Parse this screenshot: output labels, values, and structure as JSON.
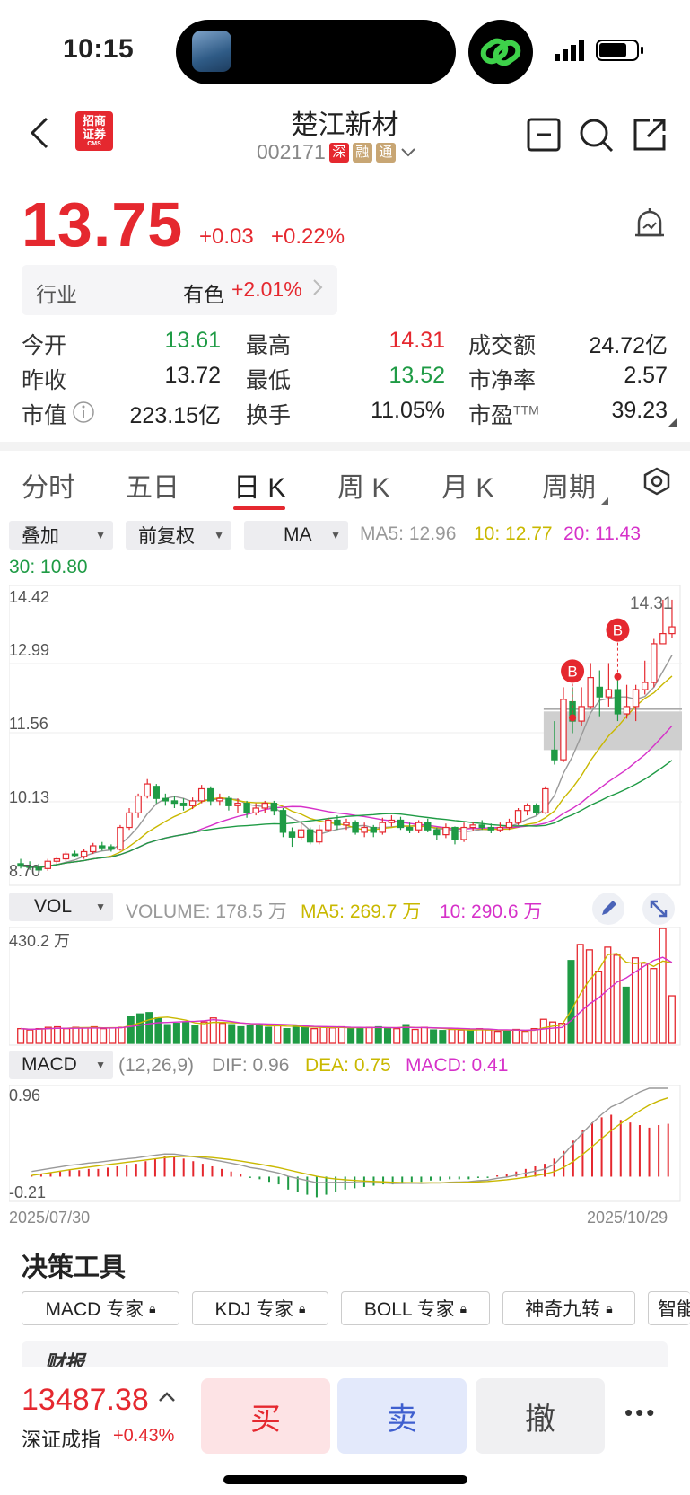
{
  "status_bar": {
    "time": "10:15"
  },
  "header": {
    "back_icon": "chevron-left-icon",
    "broker_logo_text": "招商证券",
    "broker_logo_sub": "CMS",
    "stock_name": "楚江新材",
    "stock_code": "002171",
    "tags": [
      "深",
      "融",
      "通"
    ],
    "actions": [
      "minus-box-icon",
      "search-icon",
      "share-icon"
    ]
  },
  "quote": {
    "price": "13.75",
    "change": "+0.03",
    "change_pct": "+0.22%",
    "industry_label": "行业",
    "industry_name": "有色",
    "industry_change": "+2.01%",
    "stats": [
      [
        {
          "label": "今开",
          "value": "13.61",
          "color": "#1f9b45"
        },
        {
          "label": "最高",
          "value": "14.31",
          "color": "#e5282f"
        },
        {
          "label": "成交额",
          "value": "24.72亿",
          "color": "#222222"
        }
      ],
      [
        {
          "label": "昨收",
          "value": "13.72",
          "color": "#222222"
        },
        {
          "label": "最低",
          "value": "13.52",
          "color": "#1f9b45"
        },
        {
          "label": "市净率",
          "value": "2.57",
          "color": "#222222"
        }
      ],
      [
        {
          "label": "市值",
          "value": "223.15亿",
          "color": "#222222"
        },
        {
          "label": "换手",
          "value": "11.05%",
          "color": "#222222"
        },
        {
          "label": "市盈",
          "value": "39.23",
          "color": "#222222"
        }
      ]
    ],
    "pe_sup": "TTM"
  },
  "tabs": [
    "分时",
    "五日",
    "日 K",
    "周 K",
    "月 K",
    "周期"
  ],
  "active_tab": "日 K",
  "chart_controls": {
    "overlay": "叠加",
    "adjust": "前复权",
    "indicator": "MA",
    "ma5": "MA5: 12.96",
    "ma10": "10: 12.77",
    "ma20": "20: 11.43",
    "ma30": "30: 10.80"
  },
  "volume_controls": {
    "select": "VOL",
    "volume": "VOLUME: 178.5 万",
    "ma5": "MA5: 269.7 万",
    "ma10": "10: 290.6 万",
    "max_label": "430.2 万"
  },
  "macd_controls": {
    "select": "MACD",
    "params": "(12,26,9)",
    "dif": "DIF: 0.96",
    "dea": "DEA: 0.75",
    "macd": "MACD: 0.41",
    "top_label": "0.96",
    "bottom_label": "-0.21"
  },
  "dates": {
    "start": "2025/07/30",
    "end": "2025/10/29"
  },
  "chart_data": {
    "type": "candlestick",
    "y_axis_labels": [
      "14.42",
      "12.99",
      "11.56",
      "10.13",
      "8.70"
    ],
    "ylim": [
      8.7,
      14.42
    ],
    "high_marker": "14.31",
    "buy_markers": [
      "B",
      "B"
    ],
    "candles": [
      [
        8.85,
        8.8,
        8.95,
        8.75
      ],
      [
        8.8,
        8.78,
        8.9,
        8.72
      ],
      [
        8.78,
        8.72,
        8.85,
        8.68
      ],
      [
        8.75,
        8.9,
        8.95,
        8.7
      ],
      [
        8.9,
        8.95,
        9.0,
        8.85
      ],
      [
        8.95,
        9.05,
        9.1,
        8.9
      ],
      [
        9.05,
        9.02,
        9.12,
        8.98
      ],
      [
        9.0,
        9.1,
        9.15,
        8.95
      ],
      [
        9.1,
        9.22,
        9.28,
        9.05
      ],
      [
        9.22,
        9.18,
        9.3,
        9.12
      ],
      [
        9.2,
        9.15,
        9.25,
        9.1
      ],
      [
        9.15,
        9.6,
        9.65,
        9.12
      ],
      [
        9.6,
        9.9,
        10.0,
        9.55
      ],
      [
        9.9,
        10.25,
        10.3,
        9.8
      ],
      [
        10.25,
        10.5,
        10.6,
        10.2
      ],
      [
        10.45,
        10.2,
        10.5,
        10.1
      ],
      [
        10.2,
        10.15,
        10.3,
        10.05
      ],
      [
        10.15,
        10.1,
        10.25,
        10.0
      ],
      [
        10.1,
        10.05,
        10.2,
        9.95
      ],
      [
        10.05,
        10.15,
        10.22,
        9.98
      ],
      [
        10.15,
        10.4,
        10.48,
        10.1
      ],
      [
        10.4,
        10.15,
        10.45,
        10.05
      ],
      [
        10.15,
        10.2,
        10.3,
        10.05
      ],
      [
        10.2,
        10.05,
        10.25,
        9.95
      ],
      [
        10.05,
        10.1,
        10.2,
        9.9
      ],
      [
        10.1,
        9.9,
        10.15,
        9.8
      ],
      [
        9.9,
        10.0,
        10.1,
        9.85
      ],
      [
        10.0,
        10.1,
        10.15,
        9.9
      ],
      [
        10.1,
        9.95,
        10.15,
        9.85
      ],
      [
        9.95,
        9.5,
        10.0,
        9.4
      ],
      [
        9.5,
        9.4,
        9.6,
        9.2
      ],
      [
        9.4,
        9.55,
        9.7,
        9.35
      ],
      [
        9.55,
        9.3,
        9.6,
        9.25
      ],
      [
        9.3,
        9.55,
        9.65,
        9.25
      ],
      [
        9.55,
        9.75,
        9.8,
        9.5
      ],
      [
        9.75,
        9.65,
        9.85,
        9.55
      ],
      [
        9.65,
        9.7,
        9.78,
        9.55
      ],
      [
        9.7,
        9.5,
        9.75,
        9.45
      ],
      [
        9.5,
        9.6,
        9.7,
        9.4
      ],
      [
        9.6,
        9.5,
        9.65,
        9.4
      ],
      [
        9.5,
        9.7,
        9.8,
        9.45
      ],
      [
        9.7,
        9.75,
        9.85,
        9.62
      ],
      [
        9.75,
        9.6,
        9.82,
        9.55
      ],
      [
        9.6,
        9.55,
        9.7,
        9.48
      ],
      [
        9.55,
        9.7,
        9.75,
        9.48
      ],
      [
        9.7,
        9.55,
        9.78,
        9.5
      ],
      [
        9.55,
        9.45,
        9.6,
        9.35
      ],
      [
        9.45,
        9.6,
        9.68,
        9.38
      ],
      [
        9.6,
        9.35,
        9.62,
        9.25
      ],
      [
        9.35,
        9.6,
        9.7,
        9.3
      ],
      [
        9.6,
        9.65,
        9.72,
        9.52
      ],
      [
        9.65,
        9.6,
        9.75,
        9.55
      ],
      [
        9.6,
        9.55,
        9.68,
        9.48
      ],
      [
        9.55,
        9.6,
        9.7,
        9.5
      ],
      [
        9.6,
        9.7,
        9.78,
        9.55
      ],
      [
        9.7,
        9.95,
        10.0,
        9.65
      ],
      [
        9.95,
        10.05,
        10.1,
        9.85
      ],
      [
        10.05,
        9.9,
        10.1,
        9.85
      ],
      [
        9.9,
        10.4,
        10.45,
        9.88
      ],
      [
        11.2,
        11.0,
        11.8,
        10.9
      ],
      [
        11.0,
        12.25,
        12.5,
        10.95
      ],
      [
        12.2,
        11.8,
        12.5,
        11.55
      ],
      [
        11.8,
        12.1,
        12.5,
        11.7
      ],
      [
        12.1,
        12.7,
        13.0,
        12.05
      ],
      [
        12.5,
        12.3,
        12.85,
        11.9
      ],
      [
        12.3,
        12.45,
        13.0,
        12.1
      ],
      [
        12.45,
        11.95,
        12.75,
        11.8
      ],
      [
        11.95,
        12.1,
        12.55,
        11.85
      ],
      [
        12.1,
        12.45,
        12.55,
        11.8
      ],
      [
        12.45,
        12.6,
        13.05,
        12.35
      ],
      [
        12.6,
        13.4,
        13.5,
        12.5
      ],
      [
        13.4,
        13.61,
        14.31,
        13.5
      ],
      [
        13.61,
        13.75,
        14.31,
        13.52
      ]
    ],
    "ma5_last": 12.96,
    "ma10_last": 12.77,
    "ma20_last": 11.43,
    "ma30_last": 10.8
  },
  "volume_data": {
    "unit": "万",
    "max": 430.2,
    "values": [
      [
        55,
        1
      ],
      [
        50,
        1
      ],
      [
        55,
        1
      ],
      [
        60,
        1
      ],
      [
        62,
        1
      ],
      [
        55,
        1
      ],
      [
        60,
        1
      ],
      [
        58,
        1
      ],
      [
        62,
        1
      ],
      [
        55,
        1
      ],
      [
        58,
        1
      ],
      [
        60,
        1
      ],
      [
        100,
        0
      ],
      [
        110,
        0
      ],
      [
        115,
        0
      ],
      [
        95,
        0
      ],
      [
        70,
        0
      ],
      [
        75,
        0
      ],
      [
        78,
        0
      ],
      [
        65,
        0
      ],
      [
        80,
        1
      ],
      [
        95,
        1
      ],
      [
        75,
        1
      ],
      [
        70,
        0
      ],
      [
        62,
        0
      ],
      [
        68,
        0
      ],
      [
        70,
        0
      ],
      [
        60,
        0
      ],
      [
        70,
        1
      ],
      [
        55,
        0
      ],
      [
        65,
        0
      ],
      [
        60,
        0
      ],
      [
        55,
        1
      ],
      [
        62,
        1
      ],
      [
        58,
        1
      ],
      [
        62,
        1
      ],
      [
        55,
        0
      ],
      [
        58,
        0
      ],
      [
        60,
        1
      ],
      [
        62,
        0
      ],
      [
        58,
        0
      ],
      [
        55,
        1
      ],
      [
        70,
        0
      ],
      [
        52,
        1
      ],
      [
        60,
        1
      ],
      [
        50,
        0
      ],
      [
        48,
        0
      ],
      [
        52,
        1
      ],
      [
        50,
        1
      ],
      [
        48,
        0
      ],
      [
        55,
        1
      ],
      [
        50,
        1
      ],
      [
        45,
        1
      ],
      [
        48,
        0
      ],
      [
        52,
        1
      ],
      [
        45,
        1
      ],
      [
        55,
        1
      ],
      [
        90,
        1
      ],
      [
        80,
        1
      ],
      [
        75,
        1
      ],
      [
        310,
        0
      ],
      [
        370,
        1
      ],
      [
        350,
        1
      ],
      [
        270,
        1
      ],
      [
        360,
        1
      ],
      [
        330,
        1
      ],
      [
        210,
        0
      ],
      [
        320,
        1
      ],
      [
        300,
        1
      ],
      [
        280,
        1
      ],
      [
        430,
        1
      ],
      [
        178,
        1
      ]
    ]
  },
  "macd_data": {
    "top": 0.96,
    "bottom": -0.21,
    "bars": [
      0.01,
      0.02,
      0.03,
      0.04,
      0.05,
      0.05,
      0.06,
      0.06,
      0.07,
      0.08,
      0.09,
      0.1,
      0.12,
      0.14,
      0.16,
      0.16,
      0.14,
      0.12,
      0.1,
      0.08,
      0.06,
      0.04,
      0.02,
      -0.01,
      -0.02,
      -0.04,
      -0.06,
      -0.1,
      -0.12,
      -0.14,
      -0.16,
      -0.14,
      -0.12,
      -0.1,
      -0.09,
      -0.08,
      -0.07,
      -0.06,
      -0.06,
      -0.05,
      -0.04,
      -0.04,
      -0.03,
      -0.03,
      -0.02,
      -0.02,
      -0.02,
      -0.01,
      -0.01,
      0.01,
      0.02,
      0.04,
      0.06,
      0.08,
      0.1,
      0.14,
      0.2,
      0.28,
      0.36,
      0.42,
      0.46,
      0.48,
      0.44,
      0.42,
      0.4,
      0.38,
      0.4,
      0.41
    ]
  },
  "tools": {
    "title": "决策工具",
    "items": [
      "MACD 专家",
      "KDJ 专家",
      "BOLL 专家",
      "神奇九转",
      "智能"
    ],
    "news_snippet": "财报"
  },
  "index": {
    "value": "13487.38",
    "name": "深证成指",
    "change_pct": "+0.43%"
  },
  "actions": {
    "buy": "买",
    "sell": "卖",
    "cancel": "撤",
    "more": "•••"
  }
}
